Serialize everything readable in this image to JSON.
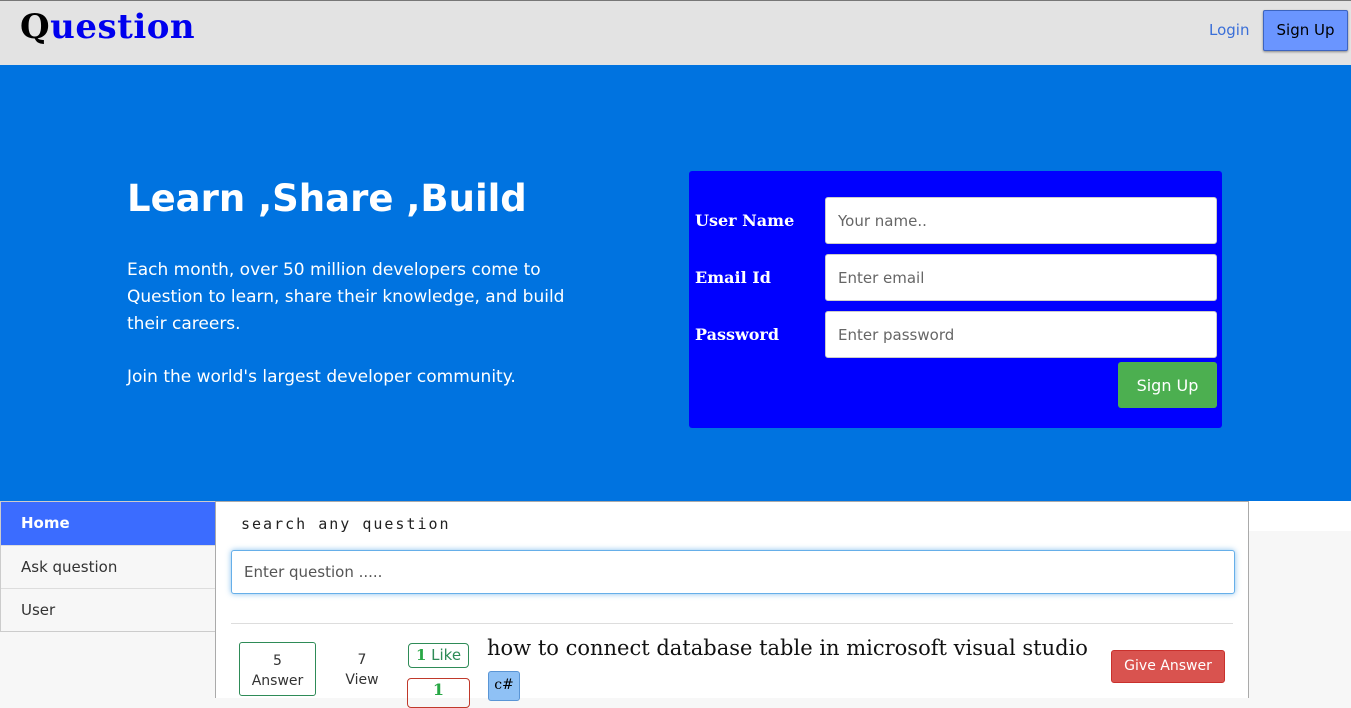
{
  "header": {
    "logo_first": "Q",
    "logo_rest": "uestion",
    "login_label": "Login",
    "signup_label": "Sign Up"
  },
  "hero": {
    "title": "Learn ,Share ,Build",
    "description": "Each month, over 50 million developers come to Question to learn, share their knowledge, and build their careers.",
    "join_text": "Join the world's largest developer community."
  },
  "signup_form": {
    "username_label": "User Name",
    "username_placeholder": "Your name..",
    "email_label": "Email Id",
    "email_placeholder": "Enter email",
    "password_label": "Password",
    "password_placeholder": "Enter password",
    "submit_label": "Sign Up"
  },
  "sidebar": {
    "items": [
      {
        "label": "Home",
        "active": true
      },
      {
        "label": "Ask question",
        "active": false
      },
      {
        "label": "User",
        "active": false
      }
    ]
  },
  "search": {
    "caption": "search any question",
    "placeholder": "Enter question ....."
  },
  "questions": [
    {
      "answers": "5",
      "answers_label": "Answer",
      "views": "7",
      "views_label": "View",
      "likes": "1",
      "likes_label": "Like",
      "dislikes": "1",
      "title": "how to connect database table in microsoft visual studio",
      "tag": "c#",
      "action_label": "Give Answer"
    }
  ],
  "colors": {
    "topbar": "#e3e3e3",
    "hero": "#0073e0",
    "form_bg": "#0000ff",
    "submit_green": "#4caf50",
    "active_nav": "#3b6cff",
    "give_answer_red": "#d9534f"
  }
}
